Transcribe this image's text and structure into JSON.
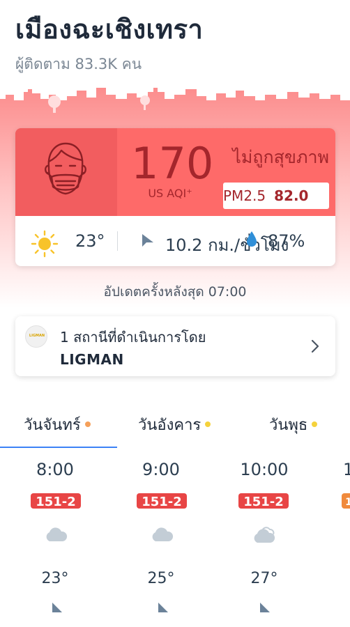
{
  "header": {
    "city": "เมืองฉะเชิงเทรา",
    "followers": "ผู้ติดตาม 83.3K คน"
  },
  "aqi": {
    "value": "170",
    "unit": "US AQI⁺",
    "status": "ไม่ถูกสุขภาพ",
    "pollutant_name": "PM2.5",
    "pollutant_value": "82.0",
    "colors": {
      "panel": "#fe6a69",
      "face_panel": "#f25d5f",
      "text": "#a4262c"
    }
  },
  "weather": {
    "temperature": "23°",
    "wind": "10.2 กม./ชั่วโมง",
    "humidity": "87%"
  },
  "updated": "อัปเดตครั้งหลังสุด 07:00",
  "station": {
    "logo_text": "LIGMAN",
    "count_text": "1 สถานีที่ดำเนินการโดย",
    "owner": "LIGMAN"
  },
  "tabs": [
    {
      "label": "วันจันทร์",
      "dot_color": "#f5a05a",
      "active": true
    },
    {
      "label": "วันอังคาร",
      "dot_color": "#f5d23c",
      "active": false
    },
    {
      "label": "วันพุธ",
      "dot_color": "#f5d23c",
      "active": false
    }
  ],
  "hourly": [
    {
      "time": "8:00",
      "aqi": "151-2",
      "temp": "23°",
      "icon": "cloud-icon"
    },
    {
      "time": "9:00",
      "aqi": "151-2",
      "temp": "25°",
      "icon": "cloud-icon"
    },
    {
      "time": "10:00",
      "aqi": "151-2",
      "temp": "27°",
      "icon": "cloud-icon"
    },
    {
      "time": "1",
      "aqi": "1",
      "temp": "",
      "icon": ""
    }
  ]
}
